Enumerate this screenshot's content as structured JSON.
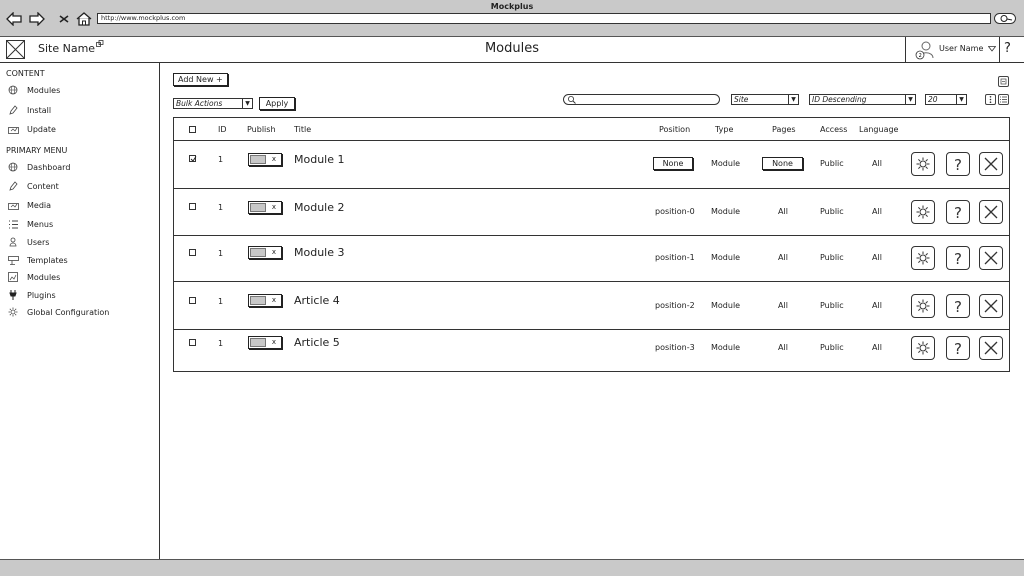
{
  "browser": {
    "title": "Mockplus",
    "url": "http://www.mockplus.com",
    "icons": [
      "back-arrow-icon",
      "forward-arrow-icon",
      "stop-icon",
      "home-icon",
      "search-icon"
    ]
  },
  "header": {
    "site_name": "Site Name",
    "page_title": "Modules",
    "user_name": "User Name",
    "help": "?"
  },
  "sidebar": {
    "content_title": "CONTENT",
    "content_items": [
      {
        "label": "Modules",
        "icon": "globe-icon"
      },
      {
        "label": "Install",
        "icon": "pen-icon"
      },
      {
        "label": "Update",
        "icon": "update-icon"
      }
    ],
    "primary_title": "PRIMARY MENU",
    "primary_items": [
      {
        "label": "Dashboard",
        "icon": "globe-icon"
      },
      {
        "label": "Content",
        "icon": "pen-icon"
      },
      {
        "label": "Media",
        "icon": "media-icon"
      },
      {
        "label": "Menus",
        "icon": "list-icon"
      },
      {
        "label": "Users",
        "icon": "user-icon"
      },
      {
        "label": "Templates",
        "icon": "template-icon"
      },
      {
        "label": "Modules",
        "icon": "module-icon"
      },
      {
        "label": "Plugins",
        "icon": "plug-icon"
      },
      {
        "label": "Global Configuration",
        "icon": "gear-icon"
      }
    ]
  },
  "toolbar": {
    "add_new": "Add New +",
    "bulk_actions": "Bulk Actions",
    "apply": "Apply",
    "search_placeholder": "",
    "filter_site": "Site",
    "sort": "ID Descending",
    "page_size": "20"
  },
  "table": {
    "headers": {
      "id": "ID",
      "publish": "Publish",
      "title": "Title",
      "position": "Position",
      "type": "Type",
      "pages": "Pages",
      "access": "Access",
      "language": "Language"
    },
    "rows": [
      {
        "checked": true,
        "id": "1",
        "publish_mark": "x",
        "title": "Module 1",
        "position": "None",
        "type": "Module",
        "pages": "None",
        "access": "Public",
        "language": "All"
      },
      {
        "checked": false,
        "id": "1",
        "publish_mark": "x",
        "title": "Module 2",
        "position": "position-0",
        "type": "Module",
        "pages": "All",
        "access": "Public",
        "language": "All"
      },
      {
        "checked": false,
        "id": "1",
        "publish_mark": "x",
        "title": "Module 3",
        "position": "position-1",
        "type": "Module",
        "pages": "All",
        "access": "Public",
        "language": "All"
      },
      {
        "checked": false,
        "id": "1",
        "publish_mark": "x",
        "title": "Article 4",
        "position": "position-2",
        "type": "Module",
        "pages": "All",
        "access": "Public",
        "language": "All"
      },
      {
        "checked": false,
        "id": "1",
        "publish_mark": "x",
        "title": "Article 5",
        "position": "position-3",
        "type": "Module",
        "pages": "All",
        "access": "Public",
        "language": "All"
      }
    ],
    "row_actions": [
      "settings-icon",
      "help-icon",
      "delete-icon"
    ]
  }
}
